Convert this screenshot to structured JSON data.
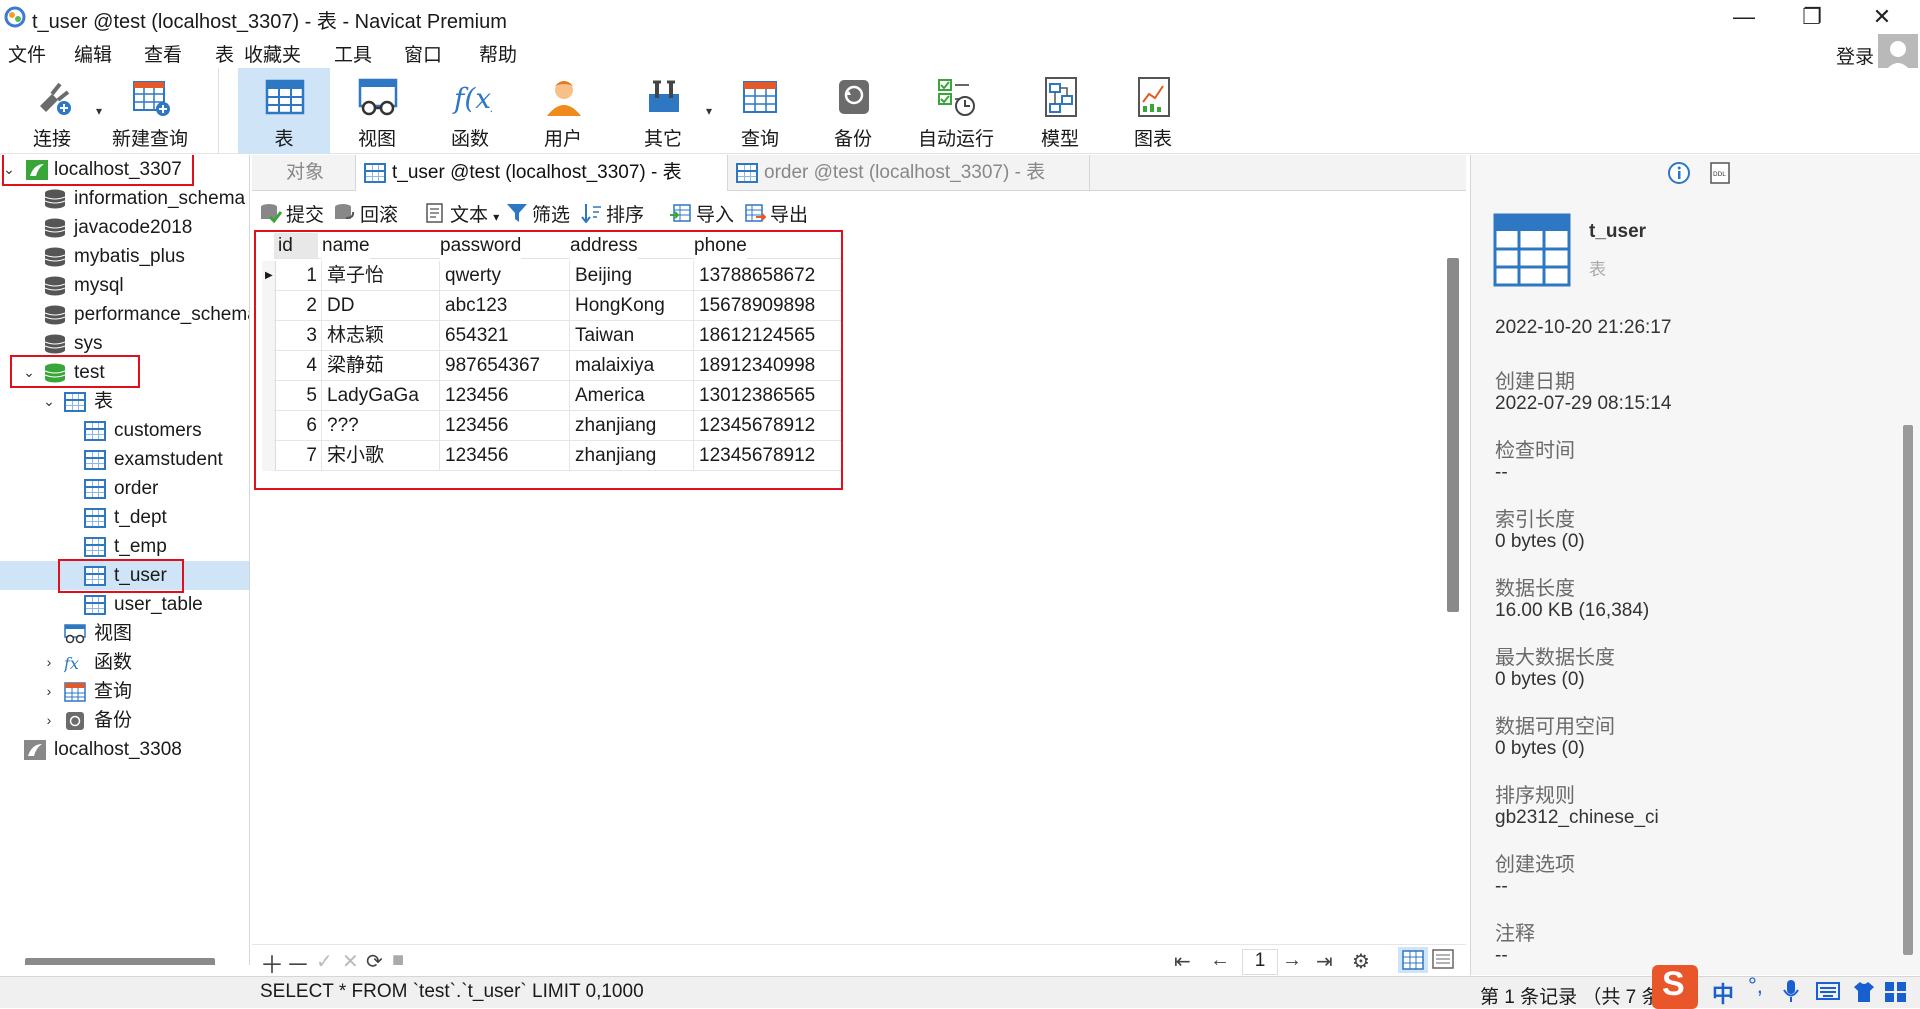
{
  "window": {
    "title": "t_user @test (localhost_3307) - 表 - Navicat Premium",
    "minimize": "—",
    "maximize": "❐",
    "close": "✕"
  },
  "menu": {
    "items": [
      "文件",
      "编辑",
      "查看",
      "表",
      "收藏夹",
      "工具",
      "窗口",
      "帮助"
    ],
    "login": "登录"
  },
  "toolbar": {
    "buttons": [
      {
        "label": "连接",
        "icon": "plug-icon"
      },
      {
        "label": "新建查询",
        "icon": "new-query-icon"
      },
      {
        "label": "表",
        "icon": "table-icon"
      },
      {
        "label": "视图",
        "icon": "view-icon"
      },
      {
        "label": "函数",
        "icon": "function-icon"
      },
      {
        "label": "用户",
        "icon": "user-icon"
      },
      {
        "label": "其它",
        "icon": "tools-icon"
      },
      {
        "label": "查询",
        "icon": "query-icon"
      },
      {
        "label": "备份",
        "icon": "backup-icon"
      },
      {
        "label": "自动运行",
        "icon": "schedule-icon"
      },
      {
        "label": "模型",
        "icon": "model-icon"
      },
      {
        "label": "图表",
        "icon": "chart-icon"
      }
    ]
  },
  "tree": {
    "connections": [
      {
        "label": "localhost_3307"
      },
      {
        "label": "localhost_3308"
      }
    ],
    "databases": [
      "information_schema",
      "javacode2018",
      "mybatis_plus",
      "mysql",
      "performance_schema",
      "sys",
      "test"
    ],
    "test_children": {
      "tables_label": "表",
      "tables": [
        "customers",
        "examstudent",
        "order",
        "t_dept",
        "t_emp",
        "t_user",
        "user_table"
      ],
      "views_label": "视图",
      "functions_label": "函数",
      "queries_label": "查询",
      "backups_label": "备份"
    }
  },
  "tabs": {
    "objects": "对象",
    "tab1": "t_user @test (localhost_3307) - 表",
    "tab2": "order @test (localhost_3307) - 表"
  },
  "subtoolbar": {
    "commit": "提交",
    "rollback": "回滚",
    "text": "文本",
    "filter": "筛选",
    "sort": "排序",
    "import": "导入",
    "export": "导出"
  },
  "grid": {
    "columns": [
      "id",
      "name",
      "password",
      "address",
      "phone"
    ],
    "rows": [
      [
        "1",
        "章子怡",
        "qwerty",
        "Beijing",
        "13788658672"
      ],
      [
        "2",
        "DD",
        "abc123",
        "HongKong",
        "15678909898"
      ],
      [
        "3",
        "林志颖",
        "654321",
        "Taiwan",
        "18612124565"
      ],
      [
        "4",
        "梁静茹",
        "987654367",
        "malaixiya",
        "18912340998"
      ],
      [
        "5",
        "LadyGaGa",
        "123456",
        "America",
        "13012386565"
      ],
      [
        "6",
        "???",
        "123456",
        "zhanjiang",
        "12345678912"
      ],
      [
        "7",
        "宋小歌",
        "123456",
        "zhanjiang",
        "12345678912"
      ]
    ]
  },
  "pager": {
    "page": "1"
  },
  "status": {
    "sql": "SELECT * FROM `test`.`t_user` LIMIT 0,1000",
    "records": "第 1 条记录 （共 7 条）"
  },
  "panel": {
    "table_name": "t_user",
    "type": "表",
    "modified": "2022-10-20 21:26:17",
    "fields": [
      {
        "label": "创建日期",
        "value": "2022-07-29 08:15:14"
      },
      {
        "label": "检查时间",
        "value": "--"
      },
      {
        "label": "索引长度",
        "value": "0 bytes (0)"
      },
      {
        "label": "数据长度",
        "value": "16.00 KB (16,384)"
      },
      {
        "label": "最大数据长度",
        "value": "0 bytes (0)"
      },
      {
        "label": "数据可用空间",
        "value": "0 bytes (0)"
      },
      {
        "label": "排序规则",
        "value": "gb2312_chinese_ci"
      },
      {
        "label": "创建选项",
        "value": "--"
      },
      {
        "label": "注释",
        "value": "--"
      }
    ]
  },
  "ime": {
    "lang": "中",
    "punct": "°,"
  },
  "colors": {
    "selection": "#cfe4f7",
    "highlight_box": "#e0101a",
    "table_blue": "#2e77c3",
    "db_green": "#3aa63a"
  }
}
